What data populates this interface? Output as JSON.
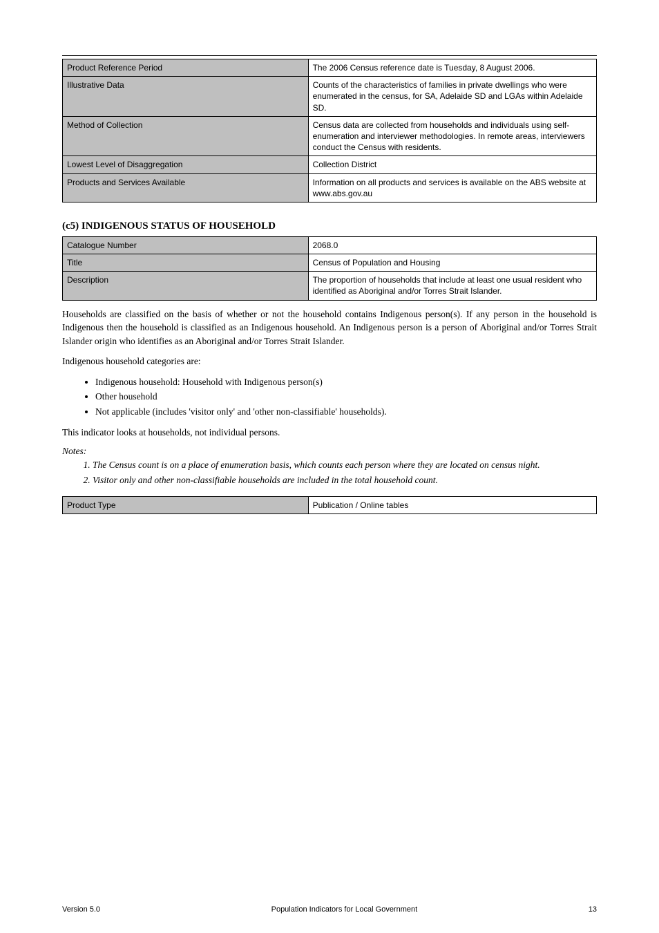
{
  "table1": {
    "rows": [
      {
        "k": "Product Reference Period",
        "v": "The 2006 Census reference date is Tuesday, 8 August 2006."
      },
      {
        "k": "Illustrative Data",
        "v": "Counts of the characteristics of families in private dwellings who were enumerated in the census, for SA, Adelaide SD and LGAs within Adelaide SD."
      },
      {
        "k": "Method of Collection",
        "v": "Census data are collected from households and individuals using self-enumeration and interviewer methodologies. In remote areas, interviewers conduct the Census with residents."
      },
      {
        "k": "Lowest Level of Disaggregation",
        "v": "Collection District"
      },
      {
        "k": "Products and Services Available",
        "v": "Information on all products and services is available on the ABS website at www.abs.gov.au"
      }
    ]
  },
  "section_c5": {
    "heading": "(c5) INDIGENOUS STATUS OF HOUSEHOLD",
    "rows": [
      {
        "k": "Catalogue Number",
        "v": "2068.0"
      },
      {
        "k": "Title",
        "v": "Census of Population and Housing"
      },
      {
        "k": "Description",
        "v": "The proportion of households that include at least one usual resident who identified as Aboriginal and/or Torres Strait Islander."
      }
    ]
  },
  "body": {
    "p1": "Households are classified on the basis of whether or not the household contains Indigenous person(s). If any person in the household is Indigenous then the household is classified as an Indigenous household. An Indigenous person is a person of Aboriginal and/or Torres Strait Islander origin who identifies as an Aboriginal and/or Torres Strait Islander.",
    "p2": "Indigenous household categories are:",
    "bullets": [
      "Indigenous household: Household with Indigenous person(s)",
      "Other household",
      "Not applicable (includes 'visitor only' and 'other non-classifiable' households)."
    ],
    "p3": "This indicator looks at households, not individual persons."
  },
  "notes": {
    "head": "Notes:",
    "items": [
      "The Census count is on a place of enumeration basis, which counts each person where they are located on census night.",
      "Visitor only and other non-classifiable households are included in the total household count."
    ]
  },
  "table3": {
    "rows": [
      {
        "k": "Product Type",
        "v": "Publication / Online tables"
      }
    ]
  },
  "footer": {
    "left": "Version 5.0",
    "center": "Population Indicators for Local Government",
    "right": "13"
  }
}
